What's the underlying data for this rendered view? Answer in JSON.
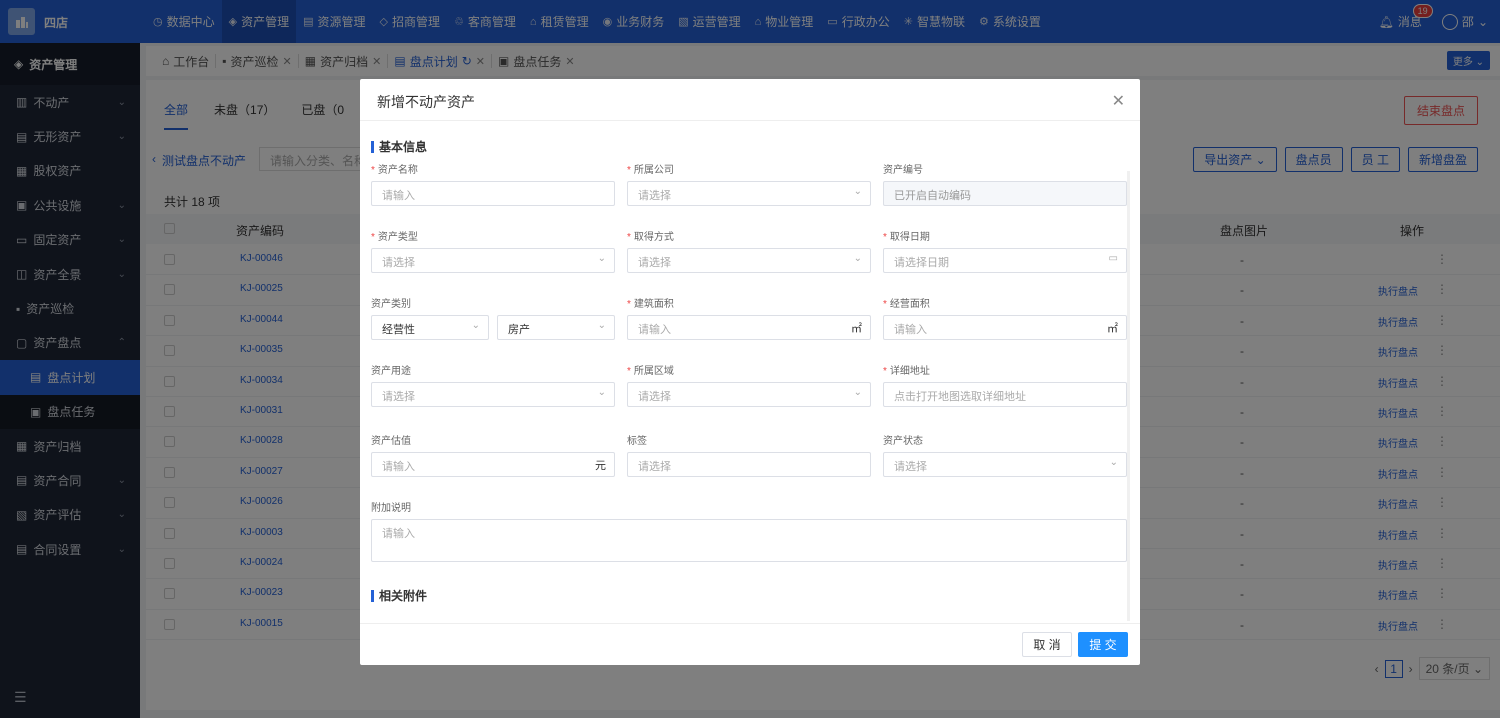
{
  "app": {
    "store": "四店"
  },
  "nav": [
    "数据中心",
    "资产管理",
    "资源管理",
    "招商管理",
    "客商管理",
    "租赁管理",
    "业务财务",
    "运营管理",
    "物业管理",
    "行政办公",
    "智慧物联",
    "系统设置"
  ],
  "top_right": {
    "messages": "消息",
    "badge": "19",
    "user": "邵"
  },
  "sidebar": {
    "head": "资产管理",
    "items": [
      "不动产",
      "无形资产",
      "股权资产",
      "公共设施",
      "固定资产",
      "资产全景",
      "资产巡检",
      "资产盘点"
    ],
    "sub": [
      "盘点计划",
      "盘点任务"
    ],
    "items2": [
      "资产归档",
      "资产合同",
      "资产评估",
      "合同设置"
    ]
  },
  "tabs": [
    "工作台",
    "资产巡检",
    "资产归档",
    "盘点计划",
    "盘点任务"
  ],
  "more": "更多",
  "subtabs": [
    "全部",
    "未盘（17）",
    "已盘（0"
  ],
  "end_btn": "结束盘点",
  "crumb": "测试盘点不动产",
  "filter_placeholder": "请输入分类、名称",
  "action_buttons": [
    "导出资产",
    "盘点员",
    "员 工",
    "新增盘盈"
  ],
  "total": "共计 18 项",
  "table": {
    "headers": [
      "资产编码",
      "盘点图片",
      "操作"
    ],
    "rows": [
      {
        "code": "KJ-00046",
        "img": "-",
        "op": ""
      },
      {
        "code": "KJ-00025",
        "img": "-",
        "op": "执行盘点"
      },
      {
        "code": "KJ-00044",
        "img": "-",
        "op": "执行盘点"
      },
      {
        "code": "KJ-00035",
        "img": "-",
        "op": "执行盘点"
      },
      {
        "code": "KJ-00034",
        "img": "-",
        "op": "执行盘点"
      },
      {
        "code": "KJ-00031",
        "img": "-",
        "op": "执行盘点"
      },
      {
        "code": "KJ-00028",
        "img": "-",
        "op": "执行盘点"
      },
      {
        "code": "KJ-00027",
        "img": "-",
        "op": "执行盘点"
      },
      {
        "code": "KJ-00026",
        "img": "-",
        "op": "执行盘点"
      },
      {
        "code": "KJ-00003",
        "img": "-",
        "op": "执行盘点"
      },
      {
        "code": "KJ-00024",
        "img": "-",
        "op": "执行盘点"
      },
      {
        "code": "KJ-00023",
        "img": "-",
        "op": "执行盘点"
      },
      {
        "code": "KJ-00015",
        "img": "-",
        "op": "执行盘点"
      }
    ]
  },
  "pager": {
    "page": "1",
    "size": "20 条/页"
  },
  "modal": {
    "title": "新增不动产资产",
    "section_basic": "基本信息",
    "section_files": "相关附件",
    "fields": {
      "name": {
        "label": "资产名称",
        "placeholder": "请输入"
      },
      "company": {
        "label": "所属公司",
        "placeholder": "请选择"
      },
      "code": {
        "label": "资产编号",
        "placeholder": "已开启自动编码"
      },
      "type": {
        "label": "资产类型",
        "placeholder": "请选择"
      },
      "acquire": {
        "label": "取得方式",
        "placeholder": "请选择"
      },
      "date": {
        "label": "取得日期",
        "placeholder": "请选择日期"
      },
      "category": {
        "label": "资产类别",
        "value1": "经营性",
        "value2": "房产"
      },
      "build_area": {
        "label": "建筑面积",
        "placeholder": "请输入",
        "unit": "㎡"
      },
      "biz_area": {
        "label": "经营面积",
        "placeholder": "请输入",
        "unit": "㎡"
      },
      "usage": {
        "label": "资产用途",
        "placeholder": "请选择"
      },
      "region": {
        "label": "所属区域",
        "placeholder": "请选择"
      },
      "address": {
        "label": "详细地址",
        "placeholder": "点击打开地图选取详细地址"
      },
      "valuation": {
        "label": "资产估值",
        "placeholder": "请输入",
        "unit": "元"
      },
      "tags": {
        "label": "标签",
        "placeholder": "请选择"
      },
      "status": {
        "label": "资产状态",
        "placeholder": "请选择"
      },
      "note": {
        "label": "附加说明",
        "placeholder": "请输入"
      }
    },
    "cancel": "取 消",
    "submit": "提 交"
  }
}
